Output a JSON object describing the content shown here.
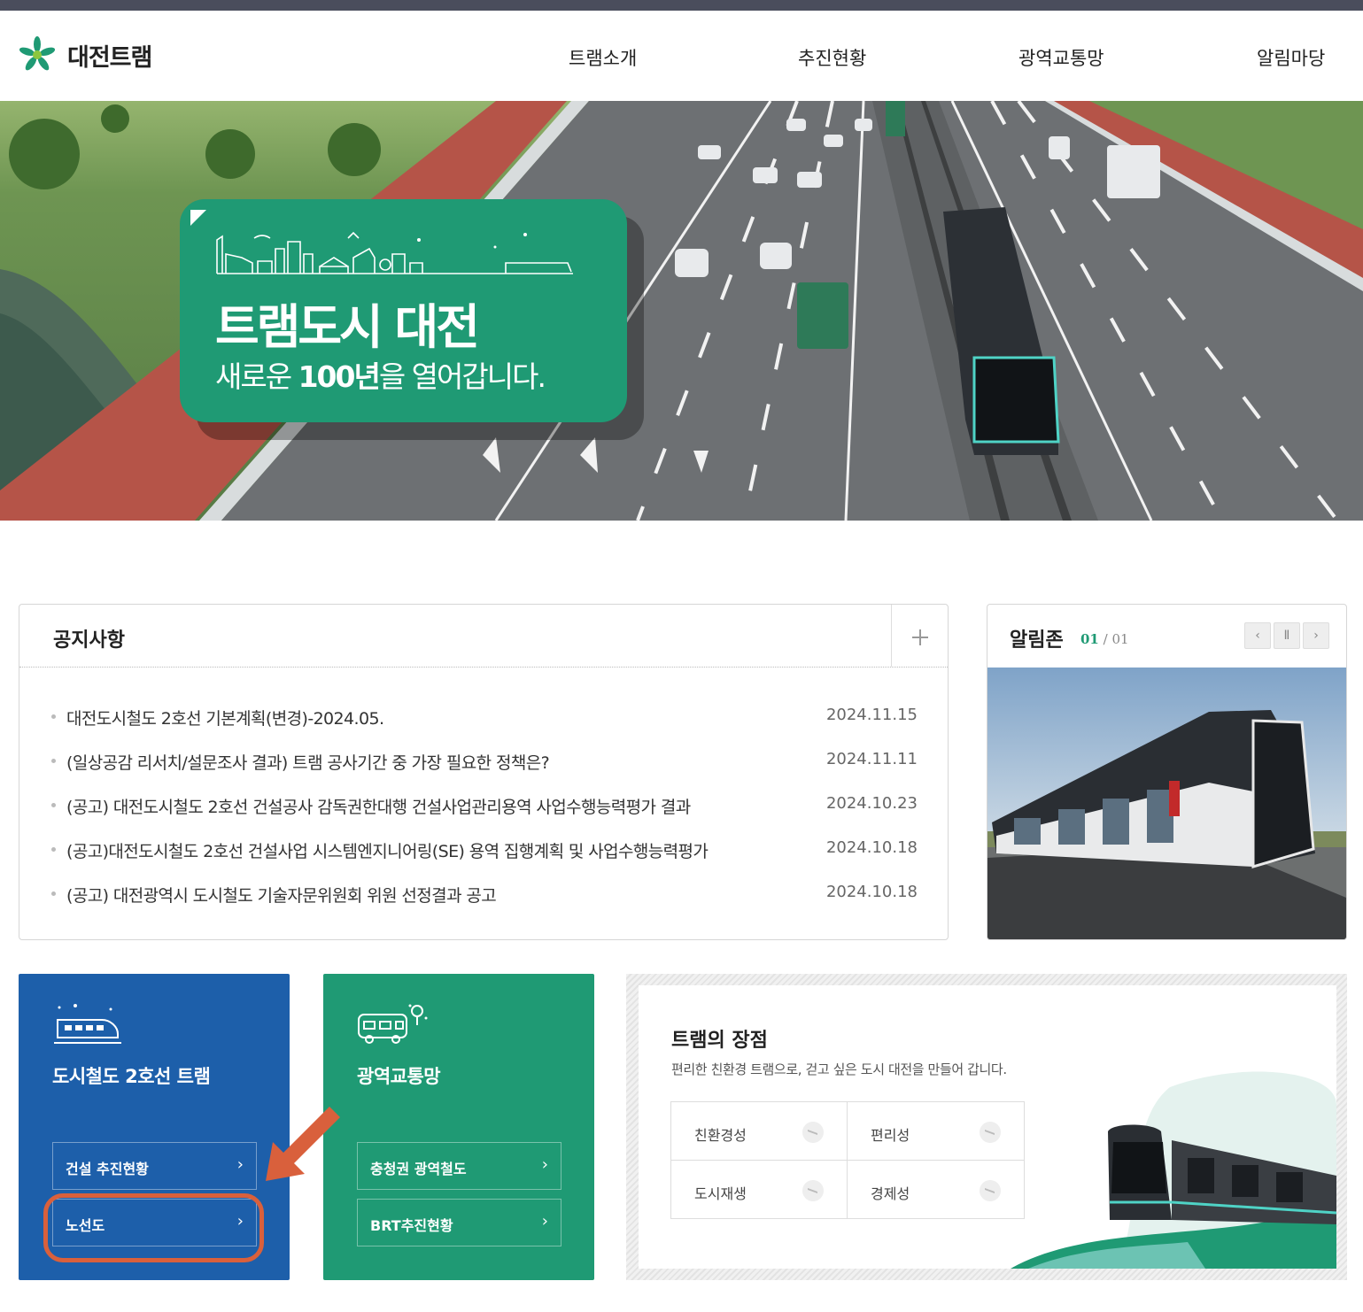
{
  "brand": {
    "name": "대전트램",
    "color": "#1f9a74"
  },
  "nav": [
    "트램소개",
    "추진현황",
    "광역교통망",
    "알림마당"
  ],
  "hero": {
    "title": "트램도시 대전",
    "subtitle_pre": "새로운 ",
    "subtitle_bold": "100년",
    "subtitle_post": "을 열어갑니다."
  },
  "notice": {
    "title": "공지사항",
    "more_icon": "plus-icon",
    "items": [
      {
        "text": "대전도시철도 2호선 기본계획(변경)-2024.05.",
        "date": "2024.11.15"
      },
      {
        "text": "(일상공감 리서치/설문조사 결과) 트램 공사기간 중 가장 필요한 정책은?",
        "date": "2024.11.11"
      },
      {
        "text": "(공고) 대전도시철도 2호선 건설공사 감독권한대행 건설사업관리용역 사업수행능력평가 결과",
        "date": "2024.10.23"
      },
      {
        "text": "(공고)대전도시철도 2호선 건설사업 시스템엔지니어링(SE) 용역 집행계획 및 사업수행능력평가",
        "date": "2024.10.18"
      },
      {
        "text": "(공고) 대전광역시 도시철도 기술자문위원회 위원 선정결과 공고",
        "date": "2024.10.18"
      }
    ]
  },
  "alimzone": {
    "title": "알림존",
    "current": "01",
    "separator": "/",
    "total": "01",
    "prev": "‹",
    "pause": "Ⅱ",
    "next": "›"
  },
  "cards": {
    "tram": {
      "title": "도시철도 2호선 트램",
      "links": [
        "건설 추진현황",
        "노선도"
      ],
      "color": "#1d5faa"
    },
    "transit": {
      "title": "광역교통망",
      "links": [
        "충청권 광역철도",
        "BRT추진현황"
      ],
      "color": "#1f9a74"
    },
    "arrow": "›"
  },
  "advantages": {
    "title": "트램의 장점",
    "desc": "편리한 친환경 트램으로, 걷고 싶은 도시 대전을 만들어 갑니다.",
    "items": [
      "친환경성",
      "편리성",
      "도시재생",
      "경제성"
    ]
  },
  "annotation_color": "#d9603c"
}
